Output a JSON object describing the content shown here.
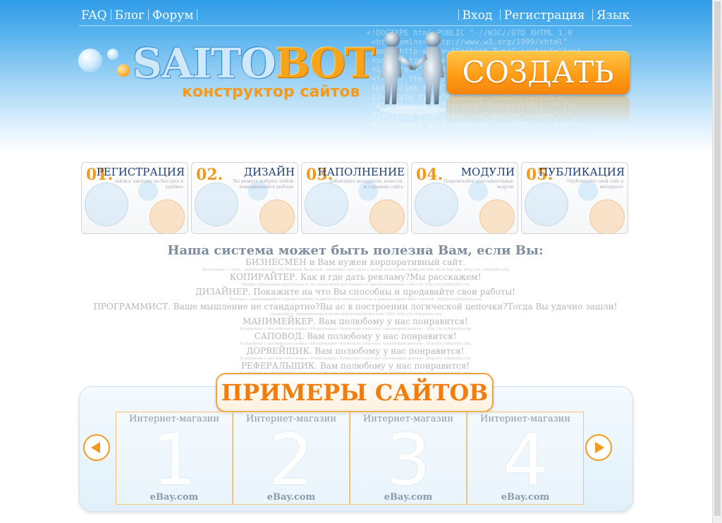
{
  "nav": {
    "left": [
      "FAQ",
      "Блог",
      "Форум"
    ],
    "right": [
      "Вход",
      "Регистрация",
      "Язык"
    ]
  },
  "logo": {
    "part1": "SAITO",
    "part2": "BOT",
    "tagline": "конструктор сайтов"
  },
  "create_button": "СОЗДАТЬ",
  "steps": [
    {
      "num": "01.",
      "title": "РЕГИСТРАЦИЯ",
      "desc": "зайти в закладку на быстрее и удобнее"
    },
    {
      "num": "02.",
      "title": "ДИЗАЙН",
      "desc": "Вы можете выбрать любой понравившийся шаблон"
    },
    {
      "num": "03.",
      "title": "НАПОЛНЕНИЕ",
      "desc": "Добавляйте материалы, новости, и страницы сайта"
    },
    {
      "num": "04.",
      "title": "МОДУЛИ",
      "desc": "Подключайте дополнительные модули"
    },
    {
      "num": "05.",
      "title": "ПУБЛИКАЦИЯ",
      "desc": "Опубликуйте свой сайт в интернете"
    }
  ],
  "useful": {
    "heading": "Наша система может быть полезна Вам, если Вы:",
    "items": [
      {
        "row": "БИЗНЕСМЕН и Вам нужен корпоративный сайт.",
        "small": "Бизнесмен — лицо, занимающееся собственным бизнесом, имеющее своё дело в целях получения прибыли или иной выгоды. http://ru.wikipedia.org"
      },
      {
        "row": "КОПИРАЙТЕР. Как и где дать рекламу?Мы расскажем!",
        "small": "Профессиональная деятельность по написанию рекламных и презентационных текстов. http://ru.wikipedia.org"
      },
      {
        "row": "ДИЗАЙНЕР. Покажите на что Вы способны и продавайте свои работы!",
        "small": "Человек, занимающийся художественно-технической деятельностью в рамках какой-либо отрасли. http://ru.wikipedia.org"
      },
      {
        "row": "ПРОГРАММИСТ. Ваше мышление не стандартно?Вы ас в построении логической цепочки?Тогда Вы удачно зашли!",
        "small": "специалист, занимающийся написанием программ для ЭВМ. http://ru.wikipedia.org"
      },
      {
        "row": "МАНИМЕЙКЕР. Вам полюбому у нас понравится!",
        "small": "В переводе с английского языка «Moneymaker» буквально означает «делающий деньги». http://ru.wikipedia.org"
      },
      {
        "row": "САПОВОД. Вам полюбому у нас понравится!",
        "small": "В переводе с английского языка «Moneymaker» буквально означает «делающий деньги». http://ru.wikipedia.org"
      },
      {
        "row": "ДОРВЕЙЩИК. Вам полюбому у нас понравится!",
        "small": "В переводе с английского языка «Moneymaker» буквально означает «делающий деньги». http://ru.wikipedia.org"
      },
      {
        "row": "РЕФЕРАЛЬЩИК. Вам полюбому у нас понравится!",
        "small": "В переводе с английского языка «Moneymaker» буквально означает «делающий деньги». http://ru.wikipedia.org"
      }
    ]
  },
  "examples": {
    "title": "ПРИМЕРЫ САЙТОВ",
    "cards": [
      {
        "label": "Интернет-магазин",
        "digit": "1",
        "footer": "eBay.com"
      },
      {
        "label": "Интернет-магазин",
        "digit": "2",
        "footer": "eBay.com"
      },
      {
        "label": "Интернет-магазин",
        "digit": "3",
        "footer": "eBay.com"
      },
      {
        "label": "Интернет-магазин",
        "digit": "4",
        "footer": "eBay.com"
      }
    ]
  },
  "colors": {
    "accent": "#f39a1c",
    "header": "#2f9be7",
    "heading": "#1c3c73"
  }
}
